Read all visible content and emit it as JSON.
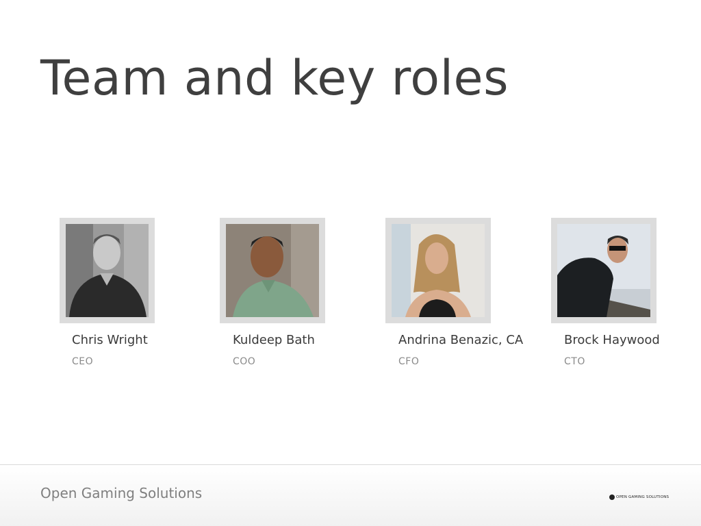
{
  "slide": {
    "title": "Team and key roles"
  },
  "team": [
    {
      "name": "Chris Wright",
      "role": "CEO"
    },
    {
      "name": "Kuldeep Bath",
      "role": "COO"
    },
    {
      "name": "Andrina Benazic, CA",
      "role": "CFO"
    },
    {
      "name": "Brock Haywood",
      "role": "CTO"
    }
  ],
  "footer": {
    "company": "Open Gaming Solutions",
    "logo_text": "OPEN GAMING SOLUTIONS"
  }
}
